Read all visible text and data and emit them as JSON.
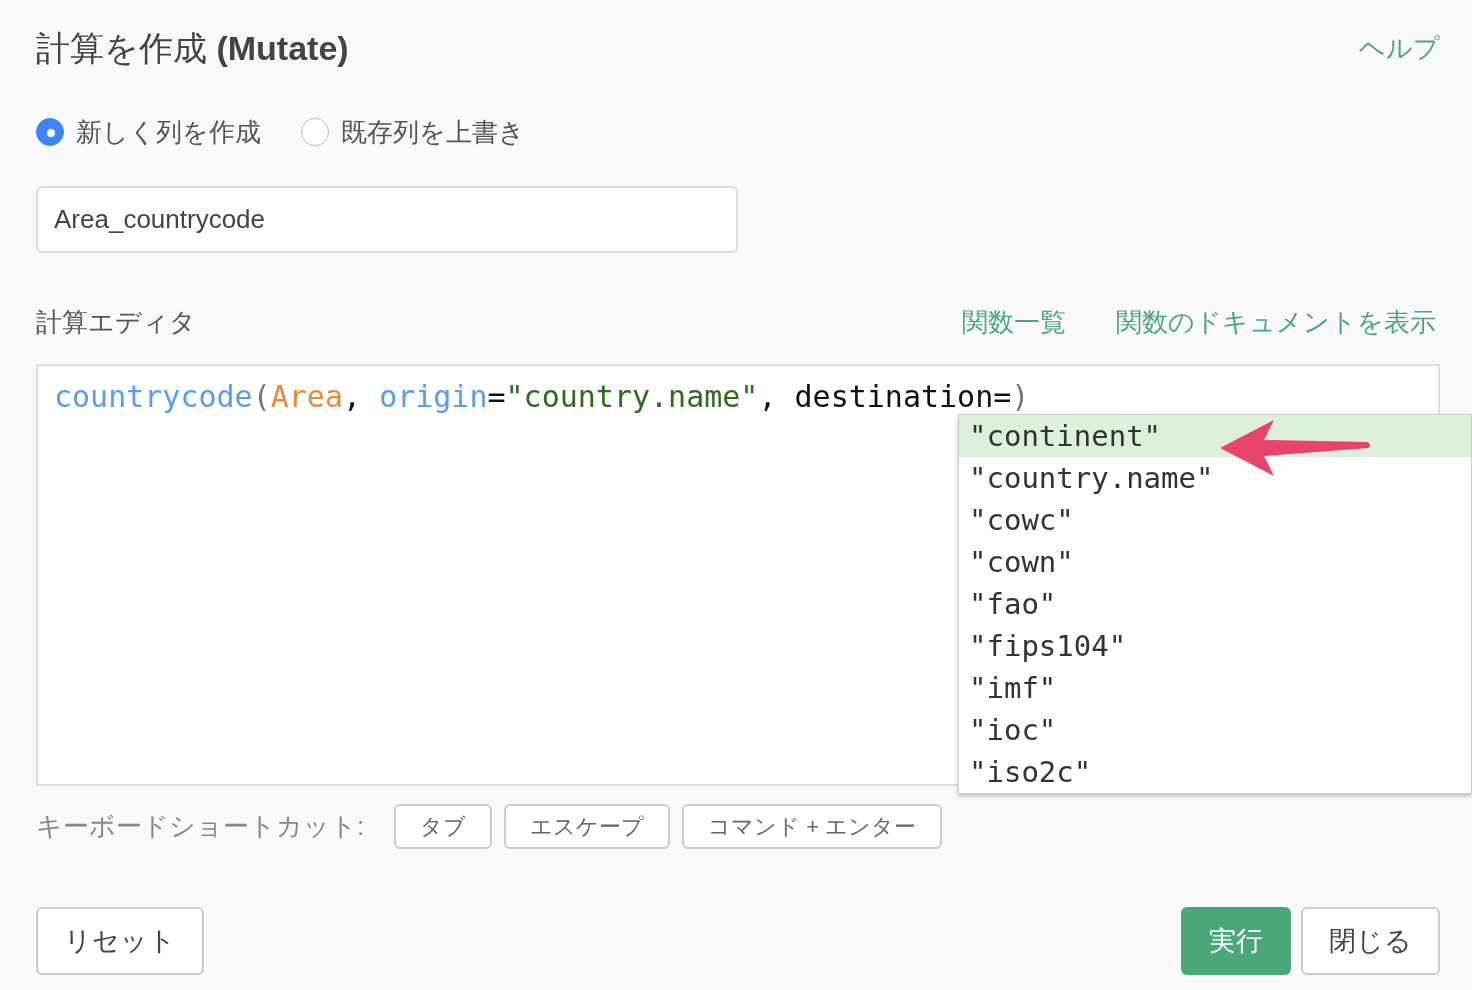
{
  "dialog": {
    "title": "計算を作成",
    "title_suffix": "(Mutate)",
    "help_link": "ヘルプ"
  },
  "mode_options": [
    {
      "label": "新しく列を作成",
      "selected": true
    },
    {
      "label": "既存列を上書き",
      "selected": false
    }
  ],
  "column_name": {
    "value": "Area_countrycode"
  },
  "editor": {
    "label": "計算エディタ",
    "links": [
      "関数一覧",
      "関数のドキュメントを表示"
    ],
    "code": [
      {
        "kind": "func",
        "text": "countrycode"
      },
      {
        "kind": "paren",
        "text": "("
      },
      {
        "kind": "arg",
        "text": "Area"
      },
      {
        "kind": "plain",
        "text": ", "
      },
      {
        "kind": "param",
        "text": "origin"
      },
      {
        "kind": "plain",
        "text": "="
      },
      {
        "kind": "string",
        "text": "\"country.name\""
      },
      {
        "kind": "plain",
        "text": ", destination="
      },
      {
        "kind": "paren",
        "text": ")"
      }
    ]
  },
  "autocomplete": [
    {
      "text": "\"continent\"",
      "selected": true
    },
    {
      "text": "\"country.name\"",
      "selected": false
    },
    {
      "text": "\"cowc\"",
      "selected": false
    },
    {
      "text": "\"cown\"",
      "selected": false
    },
    {
      "text": "\"fao\"",
      "selected": false
    },
    {
      "text": "\"fips104\"",
      "selected": false
    },
    {
      "text": "\"imf\"",
      "selected": false
    },
    {
      "text": "\"ioc\"",
      "selected": false
    },
    {
      "text": "\"iso2c\"",
      "selected": false
    }
  ],
  "shortcuts": {
    "label": "キーボードショートカット:",
    "keys": [
      "タブ",
      "エスケープ",
      "コマンド + エンター"
    ]
  },
  "footer": {
    "reset": "リセット",
    "run": "実行",
    "close": "閉じる"
  }
}
